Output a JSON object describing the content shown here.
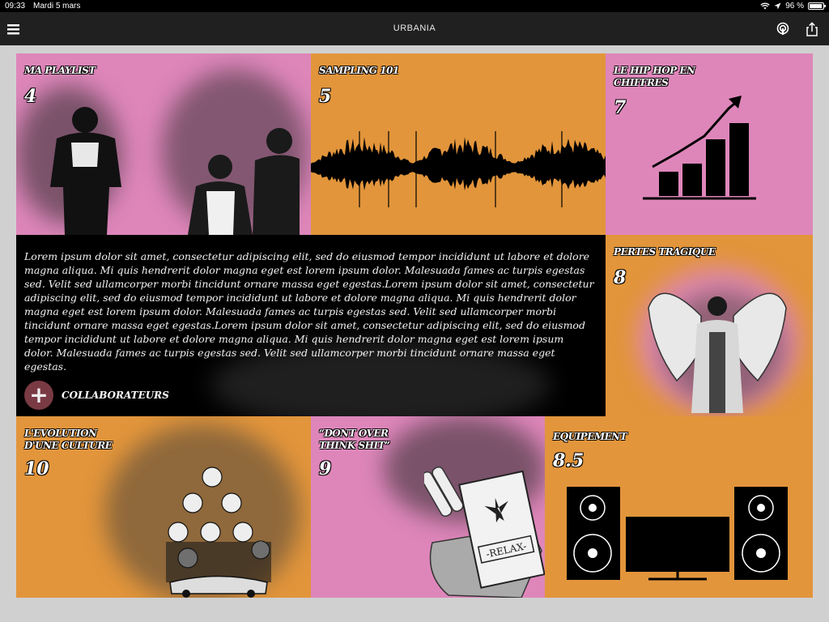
{
  "status_bar": {
    "time": "09:33",
    "date": "Mardi 5 mars",
    "battery": "96 %",
    "battery_level": 0.96
  },
  "nav": {
    "title": "URBANIA"
  },
  "tiles": [
    {
      "title": "MA PLAYLIST",
      "value": "4"
    },
    {
      "title": "SAMPLING 101",
      "value": "5"
    },
    {
      "title": "LE HIP HOP EN CHIFFRES",
      "value": "7"
    },
    {
      "title": "PERTES TRAGIQUE",
      "value": "8"
    },
    {
      "title": "L'EVOLUTION D'UNE CULTURE",
      "value": "10"
    },
    {
      "title": "“DONT OVER THINK SHIT”",
      "value": "9"
    },
    {
      "title": "EQUIPEMENT",
      "value": "8.5"
    }
  ],
  "article": {
    "text": "Lorem ipsum dolor sit amet, consectetur adipiscing elit, sed do eiusmod tempor incididunt ut labore et dolore magna aliqua. Mi quis hendrerit dolor magna eget est lorem ipsum dolor. Malesuada fames ac turpis egestas sed. Velit sed ullamcorper morbi tincidunt ornare massa eget egestas.Lorem ipsum dolor sit amet, consectetur adipiscing elit, sed do eiusmod tempor incididunt ut labore et dolore magna aliqua. Mi quis hendrerit dolor magna eget est lorem ipsum dolor. Malesuada fames ac turpis egestas sed. Velit sed ullamcorper morbi tincidunt ornare massa eget egestas.Lorem ipsum dolor sit amet, consectetur adipiscing elit, sed do eiusmod tempor incididunt ut labore et dolore magna aliqua. Mi quis hendrerit dolor magna eget est lorem ipsum dolor. Malesuada fames ac turpis egestas sed. Velit sed ullamcorper morbi tincidunt ornare massa eget egestas.",
    "collab_label": "COLLABORATEURS",
    "collab_icon": "plus-icon"
  },
  "colors": {
    "pink": "#de86ba",
    "orange": "#e2953b",
    "black": "#000000",
    "nav": "#202020",
    "plus": "#7a3a44"
  }
}
